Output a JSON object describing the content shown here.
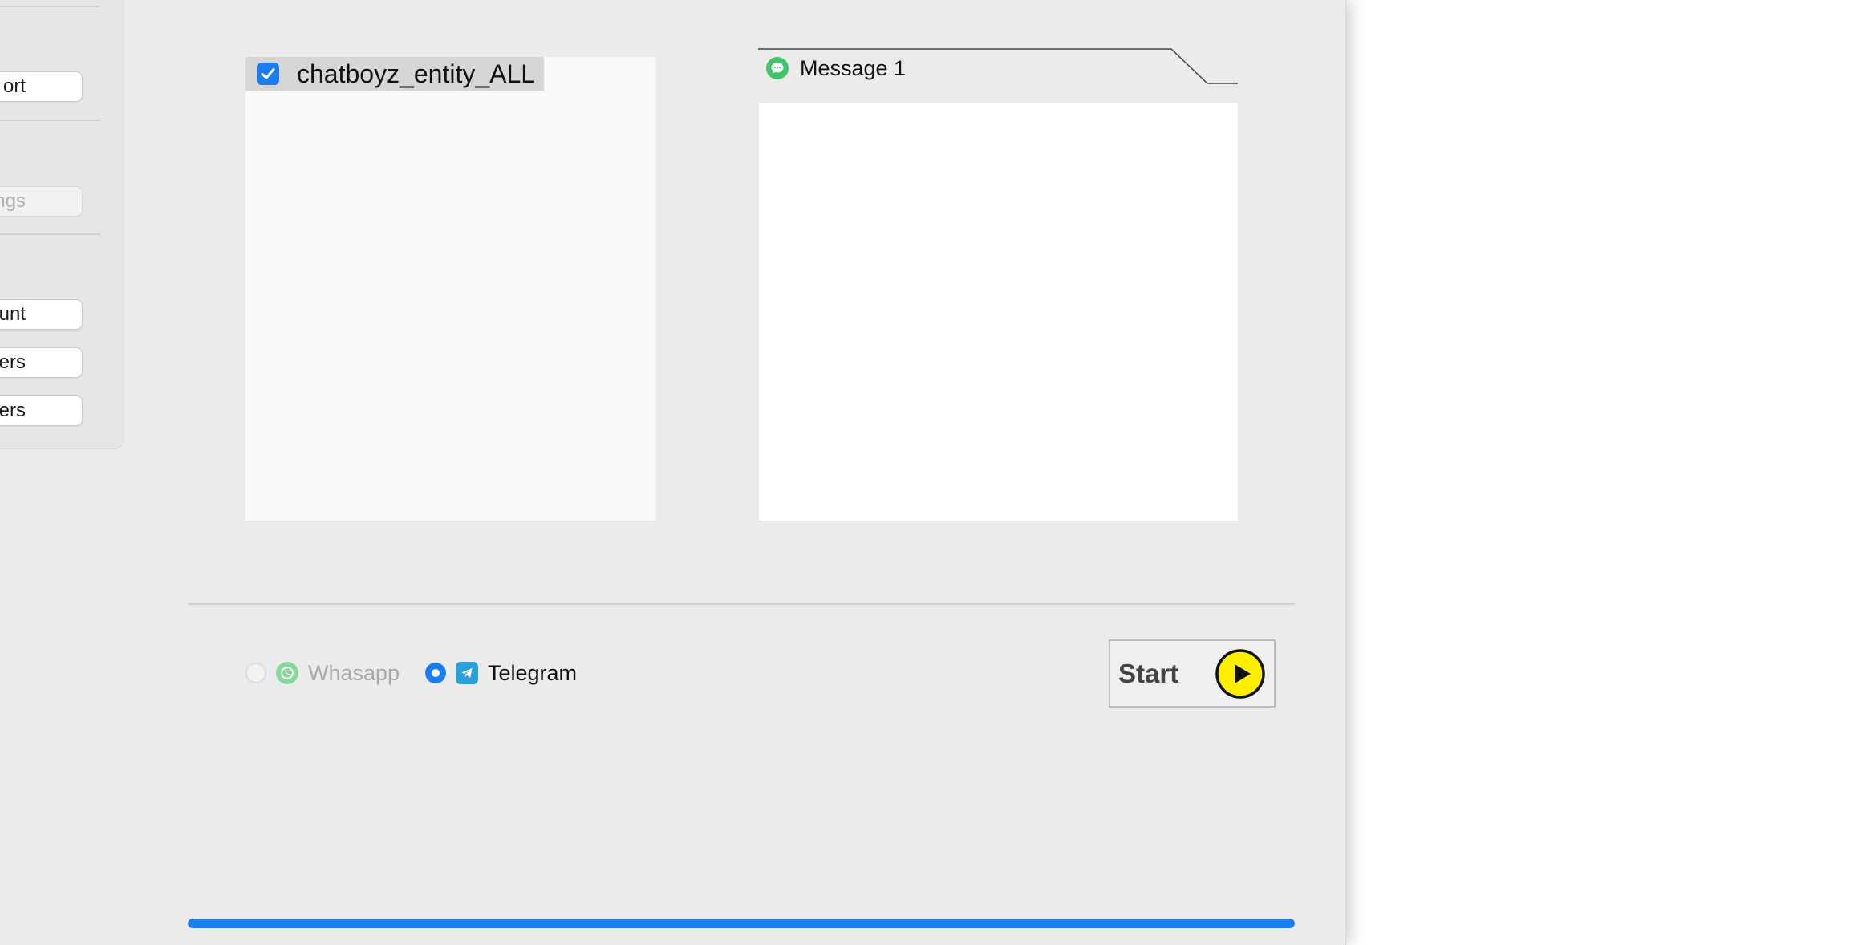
{
  "sidebar": {
    "buttons": [
      {
        "label": "Export",
        "visible_label": "ort"
      },
      {
        "label": "Settings",
        "visible_label": "ings",
        "disabled": true
      },
      {
        "label": "Account",
        "visible_label": "ount"
      },
      {
        "label": "Users",
        "visible_label": "Users"
      },
      {
        "label": "Users",
        "visible_label": "Users"
      }
    ],
    "section_fragment": "p"
  },
  "entities": [
    {
      "label": "chatboyz_entity_ALL",
      "checked": true
    }
  ],
  "message_tab": {
    "label": "Message 1",
    "body": ""
  },
  "platforms": {
    "selected": "Telegram",
    "options": [
      {
        "label": "Whasapp",
        "icon": "whatsapp-icon",
        "enabled": false
      },
      {
        "label": "Telegram",
        "icon": "telegram-icon",
        "enabled": true
      }
    ]
  },
  "start": {
    "label": "Start",
    "icon": "play-icon"
  },
  "progress": {
    "value": 1.0
  },
  "colors": {
    "accent": "#1e7cf1",
    "play": "#ffee00",
    "whatsapp": "#86d99b",
    "telegram": "#2a9fd8"
  }
}
